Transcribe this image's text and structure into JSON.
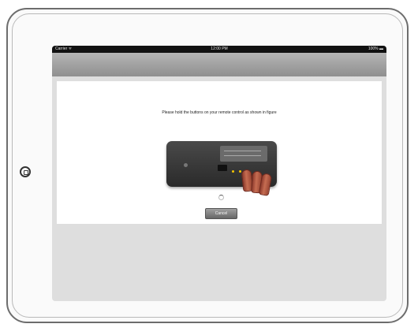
{
  "status_bar": {
    "carrier": "Carrier ᯤ",
    "time": "12:00 PM",
    "battery": "100% ▬"
  },
  "panel": {
    "instruction": "Please hold the buttons on your remote control as shown in figure",
    "cancel_label": "Cancel"
  },
  "icons": {
    "home_button": "home-button-icon",
    "spinner": "loading-spinner-icon",
    "remote_image": "remote-control-illustration"
  },
  "colors": {
    "status_bar": "#111111",
    "nav_bar": "#9f9f9f",
    "screen_background": "#dedede",
    "panel_background": "#ffffff",
    "button": "#7a7a7a",
    "indicator": "#f3c400"
  }
}
